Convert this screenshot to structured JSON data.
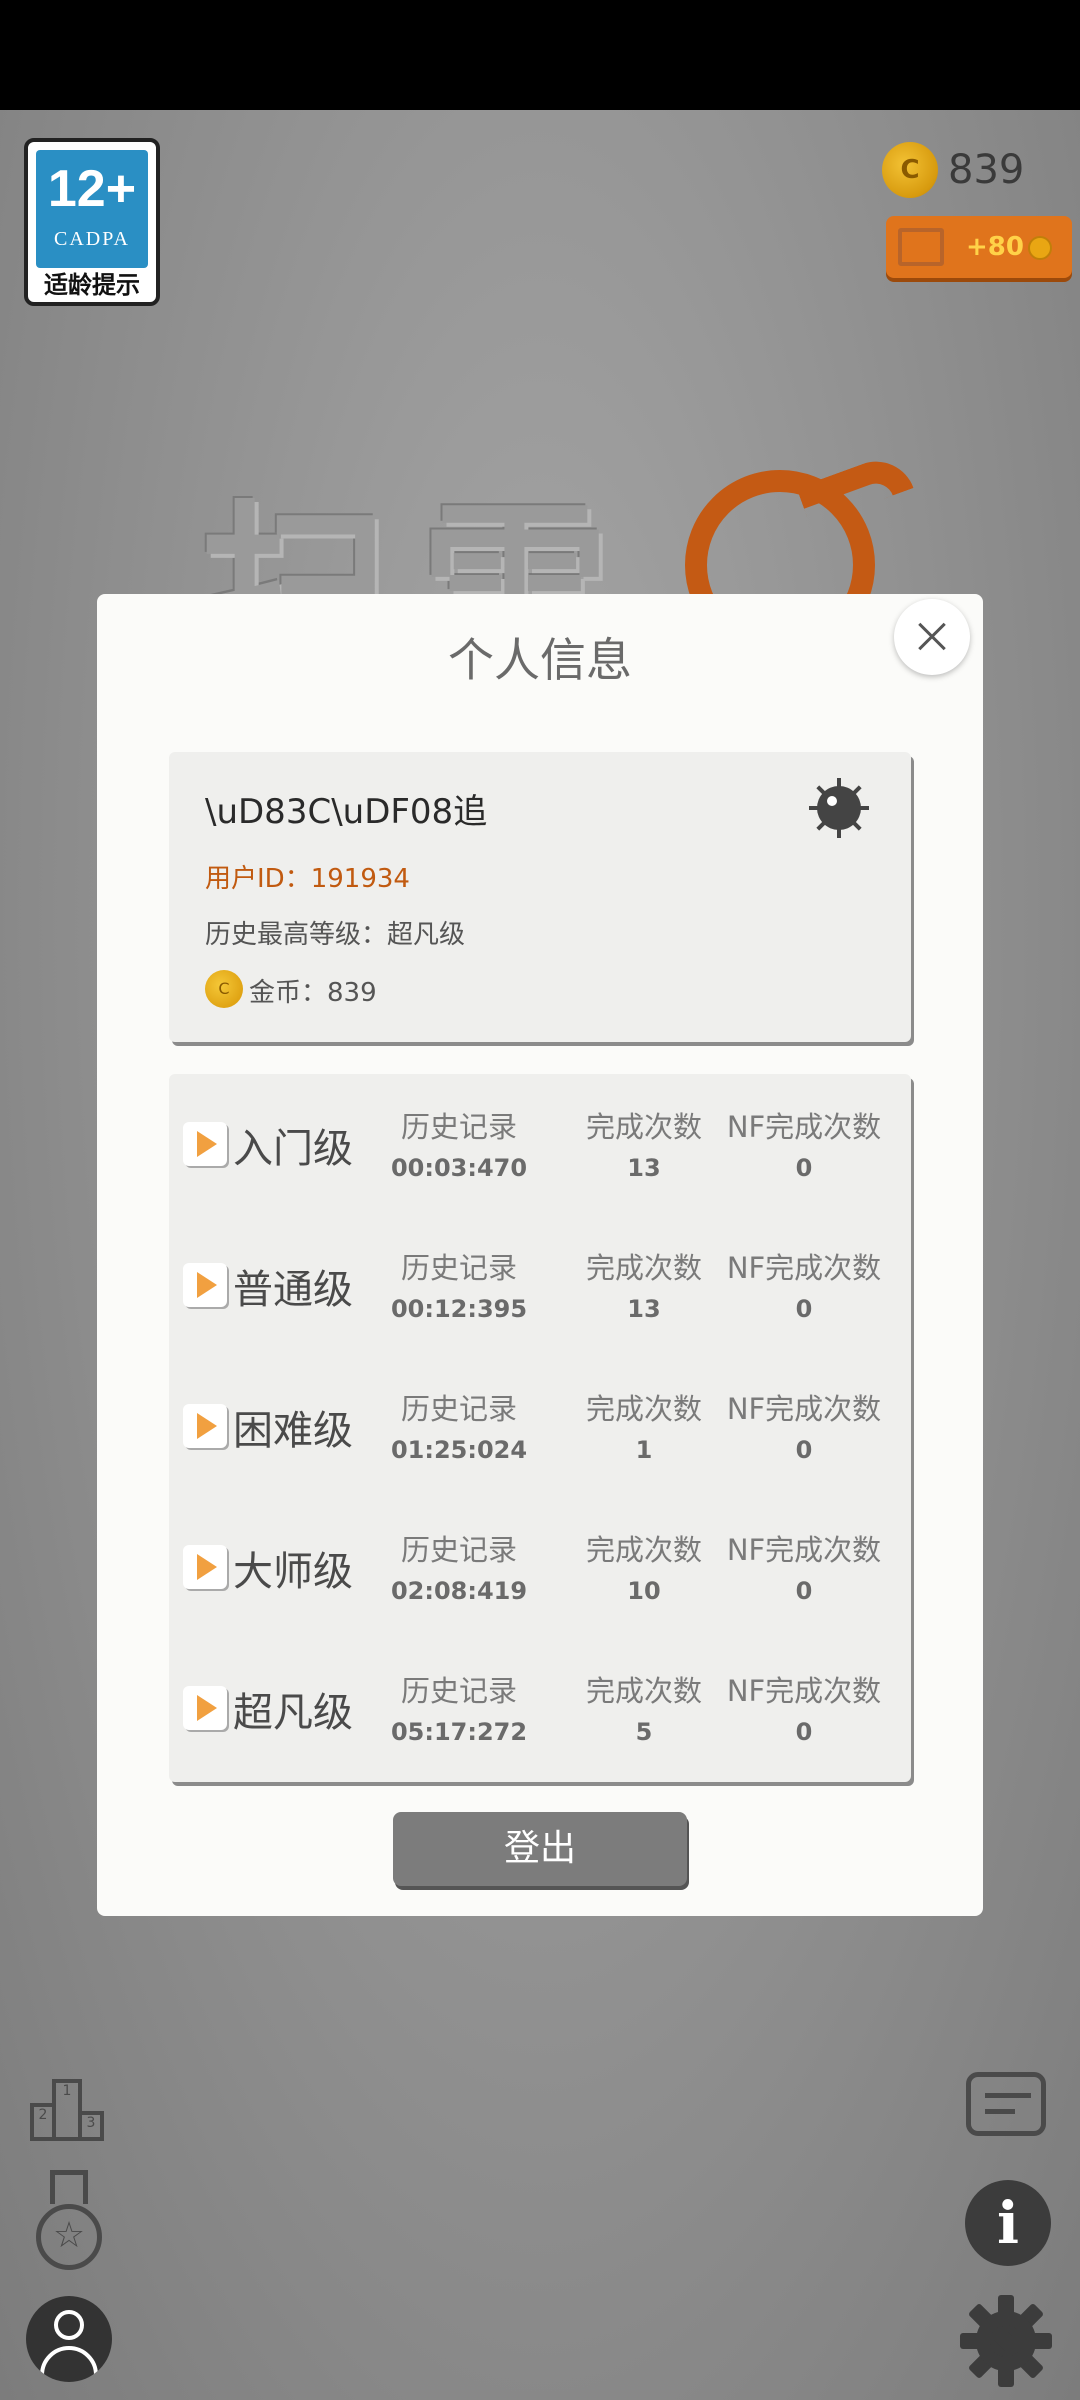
{
  "age_rating": {
    "number": "12+",
    "org": "CADPA",
    "label": "适龄提示"
  },
  "game_title": "扫雷",
  "top_bar": {
    "coins": "839",
    "ad_reward": "+80"
  },
  "modal": {
    "title": "个人信息",
    "user": {
      "name": "\\uD83C\\uDF08追",
      "id_line": "用户ID：191934",
      "level_line": "历史最高等级：超凡级",
      "coins_line": "金币：839",
      "coin_symbol": "C"
    },
    "levels": [
      {
        "name": "入门级",
        "record_label": "历史记录",
        "record": "00:03:470",
        "count_label": "完成次数",
        "count": "13",
        "nf_label": "NF完成次数",
        "nf": "0"
      },
      {
        "name": "普通级",
        "record_label": "历史记录",
        "record": "00:12:395",
        "count_label": "完成次数",
        "count": "13",
        "nf_label": "NF完成次数",
        "nf": "0"
      },
      {
        "name": "困难级",
        "record_label": "历史记录",
        "record": "01:25:024",
        "count_label": "完成次数",
        "count": "1",
        "nf_label": "NF完成次数",
        "nf": "0"
      },
      {
        "name": "大师级",
        "record_label": "历史记录",
        "record": "02:08:419",
        "count_label": "完成次数",
        "count": "10",
        "nf_label": "NF完成次数",
        "nf": "0"
      },
      {
        "name": "超凡级",
        "record_label": "历史记录",
        "record": "05:17:272",
        "count_label": "完成次数",
        "count": "5",
        "nf_label": "NF完成次数",
        "nf": "0"
      }
    ],
    "logout_label": "登出"
  },
  "icons": {
    "rank": "leaderboard-icon",
    "medal": "achievement-medal-icon",
    "avatar": "profile-avatar-icon",
    "chat": "chat-icon",
    "info": "info-icon",
    "settings": "gear-icon"
  },
  "colors": {
    "accent_orange": "#e0741c",
    "id_text": "#c15a10",
    "logout_bg": "#7c7c7c"
  }
}
